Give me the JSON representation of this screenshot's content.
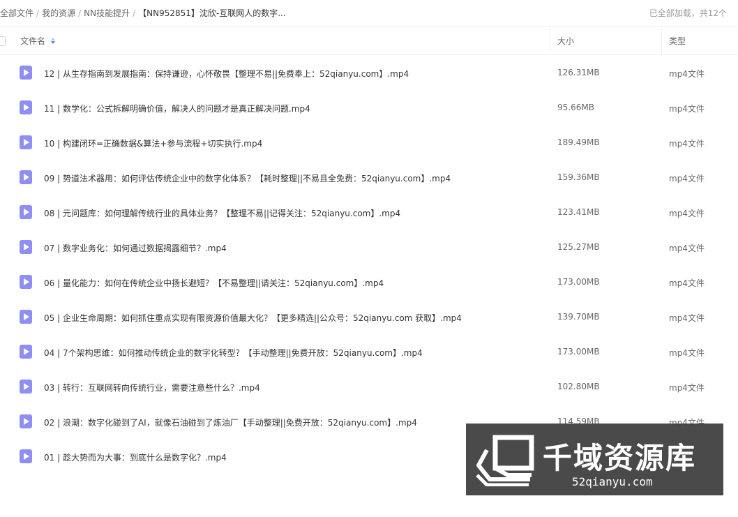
{
  "breadcrumb": {
    "items": [
      "全部文件",
      "我的资源",
      "NN技能提升"
    ],
    "current": "【NN952851】沈欣-互联网人的数字..."
  },
  "load_status": "已全部加载，共12个",
  "table": {
    "columns": {
      "name": "文件名",
      "size": "大小",
      "type": "类型"
    },
    "rows": [
      {
        "name": "12 | 从生存指南到发展指南：保持谦逊，心怀敬畏【整理不易||免费奉上：52qianyu.com】.mp4",
        "size": "126.31MB",
        "type": "mp4文件"
      },
      {
        "name": "11 | 数学化：公式拆解明确价值，解决人的问题才是真正解决问题.mp4",
        "size": "95.66MB",
        "type": "mp4文件"
      },
      {
        "name": "10 | 构建闭环=正确数据&算法+参与流程+切实执行.mp4",
        "size": "189.49MB",
        "type": "mp4文件"
      },
      {
        "name": "09 | 势道法术器用：如何评估传统企业中的数字化体系？【耗时整理||不易且全免费：52qianyu.com】.mp4",
        "size": "159.36MB",
        "type": "mp4文件"
      },
      {
        "name": "08 | 元问题库：如何理解传统行业的具体业务？【整理不易||记得关注：52qianyu.com】.mp4",
        "size": "123.41MB",
        "type": "mp4文件"
      },
      {
        "name": "07 | 数字业务化：如何通过数据揭露细节？.mp4",
        "size": "125.27MB",
        "type": "mp4文件"
      },
      {
        "name": "06 | 量化能力：如何在传统企业中扬长避短？【不易整理||请关注：52qianyu.com】.mp4",
        "size": "173.00MB",
        "type": "mp4文件"
      },
      {
        "name": "05 | 企业生命周期：如何抓住重点实现有限资源价值最大化？【更多精选||公众号：52qianyu.com 获取】.mp4",
        "size": "139.70MB",
        "type": "mp4文件"
      },
      {
        "name": "04 | 7个架构思维：如何推动传统企业的数字化转型？【手动整理||免费开放：52qianyu.com】.mp4",
        "size": "173.00MB",
        "type": "mp4文件"
      },
      {
        "name": "03 | 转行：互联网转向传统行业，需要注意些什么？.mp4",
        "size": "102.80MB",
        "type": "mp4文件"
      },
      {
        "name": "02 | 浪潮：数字化碰到了AI，就像石油碰到了炼油厂【手动整理||免费开放：52qianyu.com】.mp4",
        "size": "114.59MB",
        "type": "mp4文件"
      },
      {
        "name": "01 | 趁大势而为大事：到底什么是数字化？.mp4",
        "size": "",
        "type": ""
      }
    ]
  },
  "watermark": {
    "title": "千域资源库",
    "url": "52qianyu.com"
  },
  "colors": {
    "video_icon": "#8e8ef3",
    "sort_active": "#4a90d9",
    "watermark_bg": "#3c3c3c"
  },
  "icons": {
    "file": "video-play-icon",
    "sort": "sort-caret-icon",
    "logo": "stacked-books-logo-icon"
  }
}
